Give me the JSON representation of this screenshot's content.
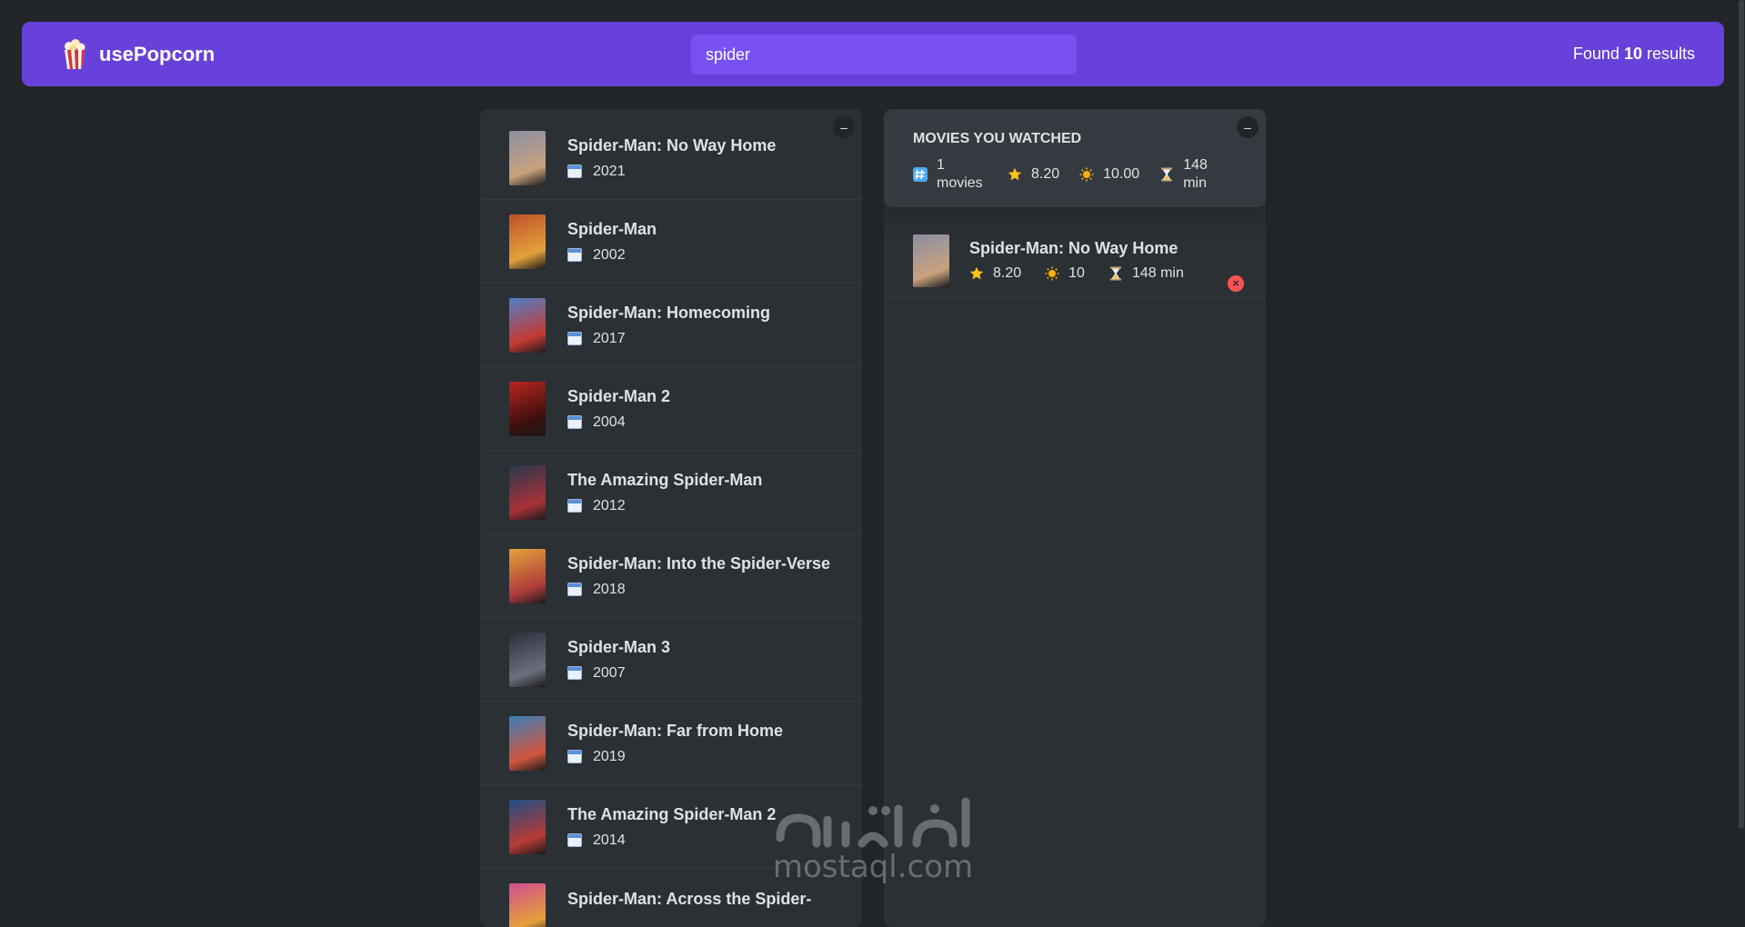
{
  "app": {
    "name": "usePopcorn",
    "logo_icon": "popcorn-icon"
  },
  "search": {
    "value": "spider",
    "placeholder": "Search movies..."
  },
  "results": {
    "prefix": "Found",
    "count": "10",
    "suffix": "results"
  },
  "movies_list": {
    "toggle_label": "–",
    "items": [
      {
        "title": "Spider-Man: No Way Home",
        "year": "2021",
        "poster_colors": [
          "#8a8fa3",
          "#c9a27e"
        ]
      },
      {
        "title": "Spider-Man",
        "year": "2002",
        "poster_colors": [
          "#c0502a",
          "#e3a23b"
        ]
      },
      {
        "title": "Spider-Man: Homecoming",
        "year": "2017",
        "poster_colors": [
          "#4f7fc7",
          "#c53a33"
        ]
      },
      {
        "title": "Spider-Man 2",
        "year": "2004",
        "poster_colors": [
          "#b8261f",
          "#3a0f0d"
        ]
      },
      {
        "title": "The Amazing Spider-Man",
        "year": "2012",
        "poster_colors": [
          "#27364f",
          "#a83238"
        ]
      },
      {
        "title": "Spider-Man: Into the Spider-Verse",
        "year": "2018",
        "poster_colors": [
          "#e0a43a",
          "#b03a3a"
        ]
      },
      {
        "title": "Spider-Man 3",
        "year": "2007",
        "poster_colors": [
          "#2c2f3a",
          "#6b6f7c"
        ]
      },
      {
        "title": "Spider-Man: Far from Home",
        "year": "2019",
        "poster_colors": [
          "#3a7fb8",
          "#d2553d"
        ]
      },
      {
        "title": "The Amazing Spider-Man 2",
        "year": "2014",
        "poster_colors": [
          "#1d4f86",
          "#b73a35"
        ]
      },
      {
        "title": "Spider-Man: Across the Spider-",
        "year": "",
        "poster_colors": [
          "#d14d8f",
          "#e6a03a"
        ]
      }
    ]
  },
  "watched": {
    "toggle_label": "–",
    "title": "MOVIES YOU WATCHED",
    "stats": {
      "count_icon": "hash-icon",
      "count_num": "1",
      "count_label": "movies",
      "imdb_icon": "star-icon",
      "imdb_rating": "8.20",
      "user_icon": "sun-icon",
      "user_rating": "10.00",
      "runtime_icon": "hourglass-icon",
      "runtime_num": "148",
      "runtime_unit": "min"
    },
    "items": [
      {
        "title": "Spider-Man: No Way Home",
        "imdb_rating": "8.20",
        "user_rating": "10",
        "runtime": "148 min",
        "delete_label": "×"
      }
    ]
  },
  "watermark": {
    "arabic": "مستقل",
    "latin": "mostaql.com"
  },
  "colors": {
    "background": "#212529",
    "nav": "#6741d9",
    "search": "#7950f2",
    "box": "#2b3035",
    "summary": "#343a40",
    "delete": "#fa5252"
  }
}
